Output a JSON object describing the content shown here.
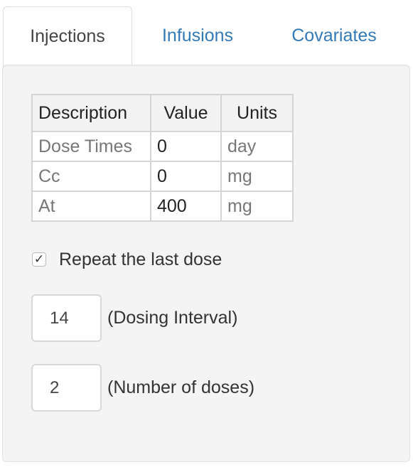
{
  "tabs": [
    {
      "label": "Injections",
      "active": true
    },
    {
      "label": "Infusions",
      "active": false
    },
    {
      "label": "Covariates",
      "active": false
    }
  ],
  "table": {
    "headers": [
      "Description",
      "Value",
      "Units"
    ],
    "rows": [
      {
        "description": "Dose Times",
        "value": "0",
        "units": "day"
      },
      {
        "description": "Cc",
        "value": "0",
        "units": "mg"
      },
      {
        "description": "At",
        "value": "400",
        "units": "mg"
      }
    ]
  },
  "repeat": {
    "label": "Repeat the last dose",
    "checked": true,
    "check_glyph": "✓"
  },
  "dosing_interval": {
    "value": "14",
    "label": "(Dosing Interval)"
  },
  "number_of_doses": {
    "value": "2",
    "label": "(Number of doses)"
  },
  "colors": {
    "link": "#337ab7",
    "active_tab_text": "#444444",
    "panel_bg": "#f4f4f4"
  }
}
